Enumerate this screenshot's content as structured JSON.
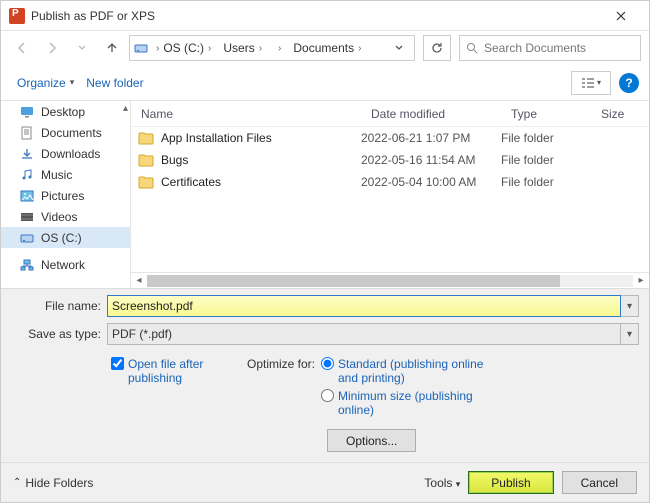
{
  "title": "Publish as PDF or XPS",
  "breadcrumbs": [
    "OS (C:)",
    "Users",
    "",
    "Documents",
    ""
  ],
  "search_placeholder": "Search Documents",
  "toolbar": {
    "organize": "Organize",
    "new_folder": "New folder"
  },
  "sidebar": {
    "items": [
      {
        "label": "Desktop"
      },
      {
        "label": "Documents"
      },
      {
        "label": "Downloads"
      },
      {
        "label": "Music"
      },
      {
        "label": "Pictures"
      },
      {
        "label": "Videos"
      },
      {
        "label": "OS (C:)"
      },
      {
        "label": "Network"
      }
    ],
    "selected": 6
  },
  "columns": {
    "name": "Name",
    "date": "Date modified",
    "type": "Type",
    "size": "Size"
  },
  "files": [
    {
      "name": "App Installation Files",
      "date": "2022-06-21 1:07 PM",
      "type": "File folder"
    },
    {
      "name": "Bugs",
      "date": "2022-05-16 11:54 AM",
      "type": "File folder"
    },
    {
      "name": "Certificates",
      "date": "2022-05-04 10:00 AM",
      "type": "File folder"
    }
  ],
  "filename_label": "File name:",
  "filename_value": "Screenshot.pdf",
  "savetype_label": "Save as type:",
  "savetype_value": "PDF (*.pdf)",
  "open_after": "Open file after publishing",
  "optimize_label": "Optimize for:",
  "opt_standard": "Standard (publishing online and printing)",
  "opt_min": "Minimum size (publishing online)",
  "options_btn": "Options...",
  "hide_folders": "Hide Folders",
  "tools": "Tools",
  "publish": "Publish",
  "cancel": "Cancel"
}
